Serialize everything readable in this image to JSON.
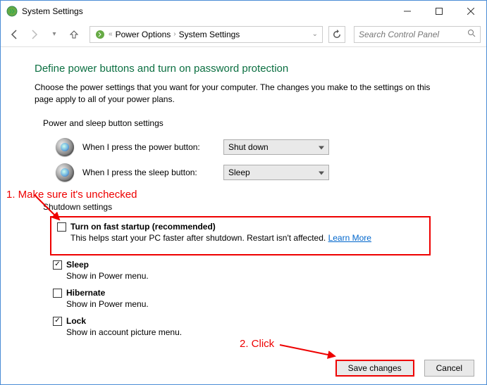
{
  "window": {
    "title": "System Settings"
  },
  "breadcrumb": {
    "item1": "Power Options",
    "item2": "System Settings"
  },
  "search": {
    "placeholder": "Search Control Panel"
  },
  "main": {
    "heading": "Define power buttons and turn on password protection",
    "intro": "Choose the power settings that you want for your computer. The changes you make to the settings on this page apply to all of your power plans.",
    "group1_title": "Power and sleep button settings",
    "power_label": "When I press the power button:",
    "power_value": "Shut down",
    "sleep_label": "When I press the sleep button:",
    "sleep_value": "Sleep",
    "group2_title": "Shutdown settings",
    "faststartup": {
      "title": "Turn on fast startup (recommended)",
      "desc_prefix": "This helps start your PC faster after shutdown. Restart isn't affected. ",
      "link": "Learn More"
    },
    "sleep_cb": {
      "title": "Sleep",
      "desc": "Show in Power menu."
    },
    "hibernate": {
      "title": "Hibernate",
      "desc": "Show in Power menu."
    },
    "lock": {
      "title": "Lock",
      "desc": "Show in account picture menu."
    }
  },
  "footer": {
    "save": "Save changes",
    "cancel": "Cancel"
  },
  "annotations": {
    "step1": "1. Make sure it's unchecked",
    "step2": "2. Click"
  }
}
